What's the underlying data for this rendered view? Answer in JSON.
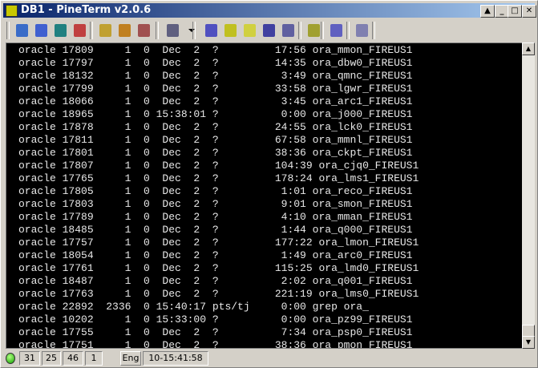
{
  "window": {
    "title": "DB1 - PineTerm v2.0.6",
    "buttons": [
      "help",
      "minimize",
      "maximize",
      "close"
    ]
  },
  "toolbar": {
    "icons": [
      "connect-icon",
      "disconnect-icon",
      "terminal-icon",
      "reconnect-icon",
      "copy-icon",
      "paste-icon",
      "paste-special-icon",
      "log-icon",
      "dropdown-arrow-icon",
      "position-icon",
      "timer-icon",
      "screen-icon",
      "slow-icon",
      "abc-icon",
      "script-icon",
      "print-icon",
      "exit-icon"
    ]
  },
  "terminal": {
    "lines": [
      "oracle 17809     1  0  Dec  2  ?         17:56 ora_mmon_FIREUS1",
      "oracle 17797     1  0  Dec  2  ?         14:35 ora_dbw0_FIREUS1",
      "oracle 18132     1  0  Dec  2  ?          3:49 ora_qmnc_FIREUS1",
      "oracle 17799     1  0  Dec  2  ?         33:58 ora_lgwr_FIREUS1",
      "oracle 18066     1  0  Dec  2  ?          3:45 ora_arc1_FIREUS1",
      "oracle 18965     1  0 15:38:01 ?          0:00 ora_j000_FIREUS1",
      "oracle 17878     1  0  Dec  2  ?         24:55 ora_lck0_FIREUS1",
      "oracle 17811     1  0  Dec  2  ?         67:58 ora_mmnl_FIREUS1",
      "oracle 17801     1  0  Dec  2  ?         38:36 ora_ckpt_FIREUS1",
      "oracle 17807     1  0  Dec  2  ?         104:39 ora_cjq0_FIREUS1",
      "oracle 17765     1  0  Dec  2  ?         178:24 ora_lms1_FIREUS1",
      "oracle 17805     1  0  Dec  2  ?          1:01 ora_reco_FIREUS1",
      "oracle 17803     1  0  Dec  2  ?          9:01 ora_smon_FIREUS1",
      "oracle 17789     1  0  Dec  2  ?          4:10 ora_mman_FIREUS1",
      "oracle 18485     1  0  Dec  2  ?          1:44 ora_q000_FIREUS1",
      "oracle 17757     1  0  Dec  2  ?         177:22 ora_lmon_FIREUS1",
      "oracle 18054     1  0  Dec  2  ?          1:49 ora_arc0_FIREUS1",
      "oracle 17761     1  0  Dec  2  ?         115:25 ora_lmd0_FIREUS1",
      "oracle 18487     1  0  Dec  2  ?          2:02 ora_q001_FIREUS1",
      "oracle 17763     1  0  Dec  2  ?         221:19 ora_lms0_FIREUS1",
      "oracle 22892  2336  0 15:40:17 pts/tj     0:00 grep ora_",
      "oracle 10202     1  0 15:33:00 ?          0:00 ora_pz99_FIREUS1",
      "oracle 17755     1  0  Dec  2  ?          7:34 ora_psp0_FIREUS1",
      "oracle 17751     1  0  Dec  2  ?         38:36 ora_pmon_FIREUS1"
    ]
  },
  "status": {
    "connection": "connected",
    "row": "31",
    "col": "25",
    "rows": "46",
    "session": "1",
    "ime": "Eng",
    "time": "10-15:41:58",
    "led_color": "#10a000"
  }
}
